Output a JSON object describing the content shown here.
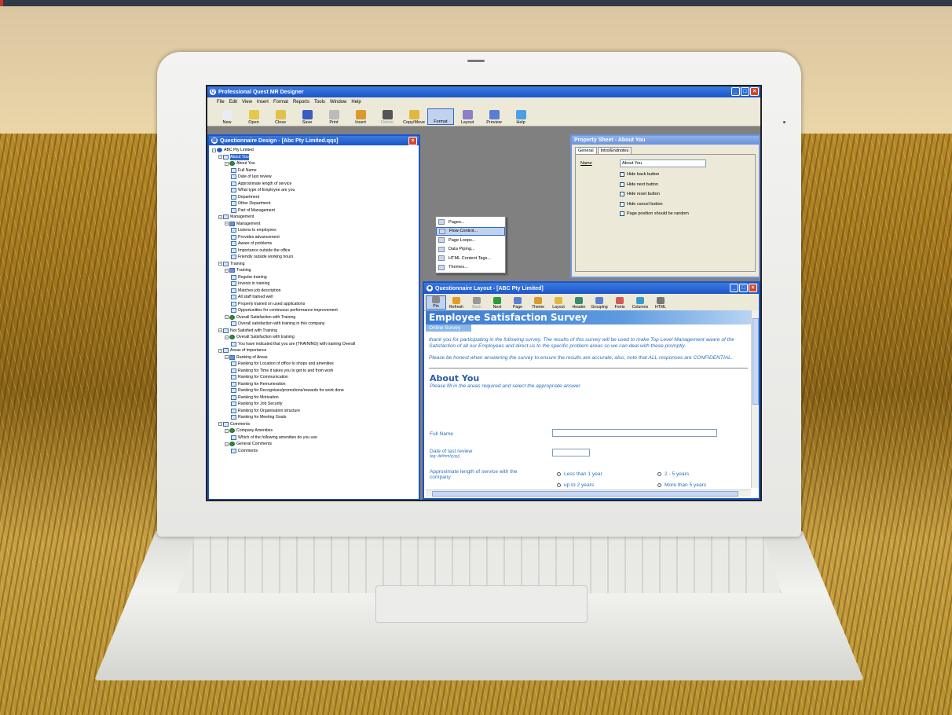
{
  "app": {
    "title": "Professional Quest MR Designer",
    "menu": [
      "File",
      "Edit",
      "View",
      "Insert",
      "Format",
      "Reports",
      "Tools",
      "Window",
      "Help"
    ],
    "toolbar": [
      "New",
      "Open",
      "Close",
      "Save",
      "Print",
      "Insert",
      "Delete",
      "Copy/Move",
      "Format",
      "Layout",
      "Preview",
      "Help"
    ]
  },
  "format_menu": [
    "Pages...",
    "Flow Control...",
    "Page Loops...",
    "Data Piping...",
    "HTML Content Tags...",
    "Themes..."
  ],
  "design": {
    "title": "Questionnaire Design - [Abc Pty Limited.qqs]",
    "tree": [
      {
        "t": "ABC Pty Limited",
        "d": 0,
        "k": "root"
      },
      {
        "t": "About You",
        "d": 1,
        "k": "page",
        "sel": true
      },
      {
        "t": "About You",
        "d": 2,
        "k": "grp"
      },
      {
        "t": "Full Name",
        "d": 3,
        "k": "q"
      },
      {
        "t": "Date of last review",
        "d": 3,
        "k": "q"
      },
      {
        "t": "Approximate length of service",
        "d": 3,
        "k": "q"
      },
      {
        "t": "What type of Employee are you",
        "d": 3,
        "k": "q"
      },
      {
        "t": "Department",
        "d": 3,
        "k": "q"
      },
      {
        "t": "Other Department",
        "d": 3,
        "k": "q"
      },
      {
        "t": "Part of Management",
        "d": 3,
        "k": "q"
      },
      {
        "t": "Management",
        "d": 1,
        "k": "page"
      },
      {
        "t": "Management",
        "d": 2,
        "k": "grid"
      },
      {
        "t": "Listens to employees",
        "d": 3,
        "k": "q"
      },
      {
        "t": "Provides advancement",
        "d": 3,
        "k": "q"
      },
      {
        "t": "Aware of problems",
        "d": 3,
        "k": "q"
      },
      {
        "t": "Importance outside the office",
        "d": 3,
        "k": "q"
      },
      {
        "t": "Friendly outside working hours",
        "d": 3,
        "k": "q"
      },
      {
        "t": "Training",
        "d": 1,
        "k": "page"
      },
      {
        "t": "Training",
        "d": 2,
        "k": "grid"
      },
      {
        "t": "Regular training",
        "d": 3,
        "k": "q"
      },
      {
        "t": "Invests in training",
        "d": 3,
        "k": "q"
      },
      {
        "t": "Matches job description",
        "d": 3,
        "k": "q"
      },
      {
        "t": "All staff trained well",
        "d": 3,
        "k": "q"
      },
      {
        "t": "Properly trained on used applications",
        "d": 3,
        "k": "q"
      },
      {
        "t": "Opportunities for continuous performance improvement",
        "d": 3,
        "k": "q"
      },
      {
        "t": "Overall Satisfaction with Training",
        "d": 2,
        "k": "grp"
      },
      {
        "t": "Overall satisfaction with training in this company",
        "d": 3,
        "k": "q"
      },
      {
        "t": "Not Satisfied with Training",
        "d": 1,
        "k": "page"
      },
      {
        "t": "Overall Satisfaction with training",
        "d": 2,
        "k": "grp"
      },
      {
        "t": "You have indicated that you are {TRAINING} with training Overall",
        "d": 3,
        "k": "q"
      },
      {
        "t": "Areas of importance",
        "d": 1,
        "k": "page"
      },
      {
        "t": "Ranking of Areas",
        "d": 2,
        "k": "grid"
      },
      {
        "t": "Ranking for Location of office to shops and amenities",
        "d": 3,
        "k": "q"
      },
      {
        "t": "Ranking for Time it takes you to get to and from work",
        "d": 3,
        "k": "q"
      },
      {
        "t": "Ranking for Communication",
        "d": 3,
        "k": "q"
      },
      {
        "t": "Ranking for Remuneration",
        "d": 3,
        "k": "q"
      },
      {
        "t": "Ranking for Recognises/promotions/rewards for work done",
        "d": 3,
        "k": "q"
      },
      {
        "t": "Ranking for Motivation",
        "d": 3,
        "k": "q"
      },
      {
        "t": "Ranking for Job Security",
        "d": 3,
        "k": "q"
      },
      {
        "t": "Ranking for Organisation structure",
        "d": 3,
        "k": "q"
      },
      {
        "t": "Ranking for Meeting Goals",
        "d": 3,
        "k": "q"
      },
      {
        "t": "Comments",
        "d": 1,
        "k": "page"
      },
      {
        "t": "Company Amenities",
        "d": 2,
        "k": "grp"
      },
      {
        "t": "Which of the following amenities do you use",
        "d": 3,
        "k": "q"
      },
      {
        "t": "General Comments",
        "d": 2,
        "k": "grp"
      },
      {
        "t": "Comments",
        "d": 3,
        "k": "q"
      }
    ]
  },
  "props": {
    "title": "Property Sheet - About You",
    "tabs": [
      "General",
      "Intro/Endnotes"
    ],
    "name_label": "Name",
    "name_value": "About You",
    "checks": [
      "Hide back button",
      "Hide next button",
      "Hide reset button",
      "Hide cancel button",
      "Page position should be random"
    ]
  },
  "layout": {
    "title": "Questionnaire Layout - [ABC Pty Limited]",
    "toolbar": [
      "Pin",
      "Refresh",
      "Back",
      "Next",
      "Page",
      "Theme",
      "Layout",
      "Header",
      "Grouping",
      "Fonts",
      "Columns",
      "HTML"
    ],
    "survey_title": "Employee Satisfaction Survey",
    "subtitle": "Online Survey",
    "intro1": "thank you for participating in the following survey. The results of this survey will be used to make Top Level Management aware of the Satisfaction of all our Employees and direct us to the specific problem areas so we can deal with these promptly.",
    "intro2": "Please be honest when answering the survey to ensure the results are accurate, also, note that ALL responses are CONFIDENTIAL.",
    "section": "About You",
    "section_hint": "Please fill in the areas required and select the appropriate answer",
    "field_fullname": "Full Name",
    "field_date": "Date of last review",
    "field_date_hint": "(eg: dd/mm/yyyy)",
    "field_service": "Approximate length of service with the company",
    "options": [
      "Less than 1 year",
      "2 - 5 years",
      "up to 2 years",
      "More than 5 years"
    ]
  },
  "colors": {
    "accent": "#1d55c8",
    "survey_text": "#2a6ebd",
    "selection": "#316ac5"
  }
}
